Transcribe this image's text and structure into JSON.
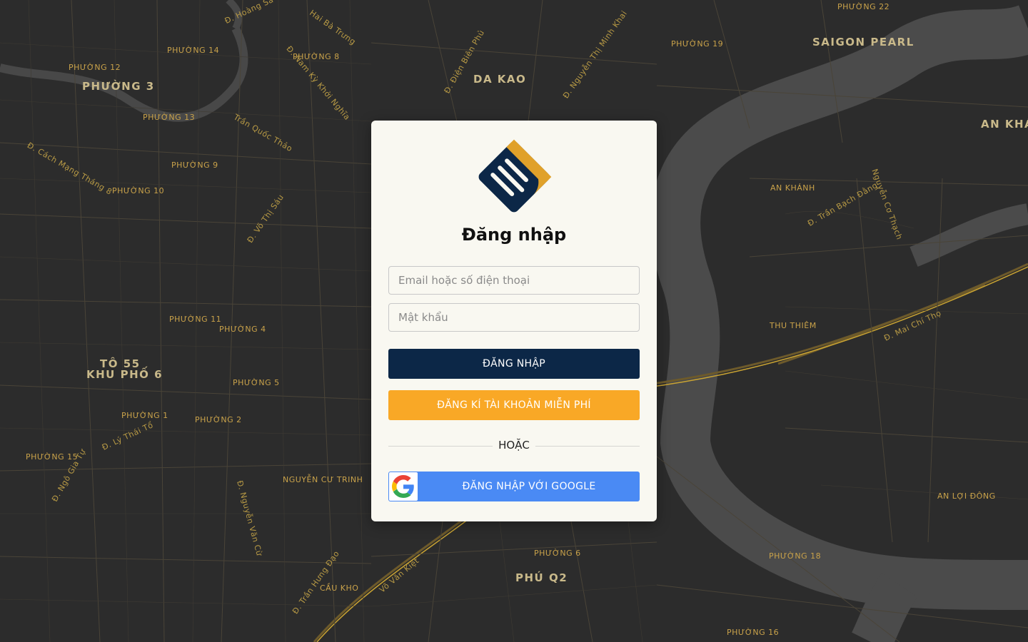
{
  "map": {
    "districts": [
      "DA KAO",
      "PHƯỜNG 3",
      "SAIGON PEARL",
      "AN KHÁ",
      "AN KHÁNH",
      "THU THIÊM",
      "PHÚ Q2",
      "CẦU KHO",
      "TÔ 55",
      "KHU PHỐ 6",
      "NGUYỄN CƯ TRINH",
      "AN LỢI ĐÔNG"
    ],
    "labels": [
      "PHƯỜNG 12",
      "PHƯỜNG 13",
      "PHƯỜNG 14",
      "PHƯỜNG 8",
      "PHƯỜNG 19",
      "PHƯỜNG 22",
      "PHƯỜNG 10",
      "PHƯỜNG 11",
      "PHƯỜNG 9",
      "PHƯỜNG 4",
      "PHƯỜNG 5",
      "PHƯỜNG 1",
      "PHƯỜNG 2",
      "PHƯỜNG 6",
      "PHƯỜNG 15",
      "PHƯỜNG 16",
      "PHƯỜNG 18"
    ],
    "streets": [
      "Đ. Hoàng Sa",
      "Hai Bà Trưng",
      "Đ. Nam Kỳ Khởi Nghĩa",
      "Đ. Võ Thị Sáu",
      "Đ. Điện Biên Phủ",
      "Đ. Nguyễn Thị Minh Khai",
      "Đ. Cách Mạng Tháng 8",
      "Trần Quốc Thảo",
      "Đ. Mai Chí Thọ",
      "Đ. Trần Bạch Đằng",
      "Nguyễn Cơ Thạch",
      "Đ. Lý Thái Tổ",
      "Đ. Nguyễn Văn Cừ",
      "Đ. Trần Hưng Đạo",
      "Võ Văn Kiệt",
      "Đ. Ngô Gia Tự"
    ]
  },
  "card": {
    "title": "Đăng nhập",
    "email_placeholder": "Email hoặc số điện thoại",
    "password_placeholder": "Mật khẩu",
    "login_label": "ĐĂNG NHẬP",
    "signup_label": "ĐĂNG KÍ TÀI KHOẢN MIỄN PHÍ",
    "divider_text": "HOẶC",
    "google_label": "ĐĂNG NHẬP VỚI GOOGLE"
  },
  "colors": {
    "map_background": "#2c2c2c",
    "river": "#4b4b4b",
    "card_background": "#f9f8f1",
    "login_button": "#0c2747",
    "signup_button": "#f9a826",
    "google_button": "#4a8af4",
    "logo_navy": "#0c2747",
    "logo_gold": "#e0a12a"
  },
  "icons": {
    "logo": "app-logo-icon",
    "google": "google-icon"
  }
}
